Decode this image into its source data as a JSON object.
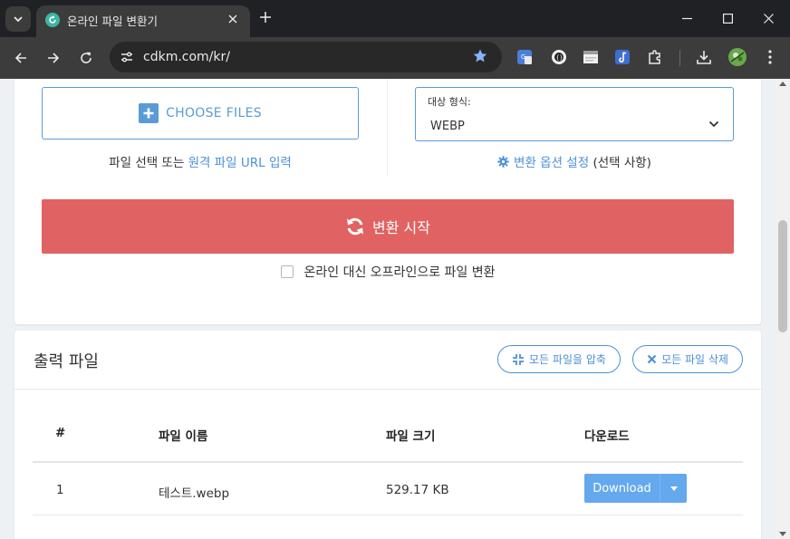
{
  "browser": {
    "tab_title": "온라인 파일 변환기",
    "url": "cdkm.com/kr/"
  },
  "converter": {
    "choose_files_label": "CHOOSE FILES",
    "file_hint_prefix": "파일 선택 또는 ",
    "file_hint_link": "원격 파일 URL 입력",
    "target_format_label": "대상 형식:",
    "target_format_value": "WEBP",
    "options_link": "변환 옵션 설정",
    "options_suffix": " (선택 사항)",
    "convert_button": "변환 시작",
    "offline_label": "온라인 대신 오프라인으로 파일 변환"
  },
  "output": {
    "title": "출력 파일",
    "compress_all": "모든 파일을 압축",
    "delete_all": "모든 파일 삭제",
    "columns": [
      "#",
      "파일 이름",
      "파일 크기",
      "다운로드"
    ],
    "rows": [
      {
        "index": "1",
        "name": "테스트.webp",
        "size": "529.17 KB",
        "download_label": "Download"
      }
    ]
  },
  "colors": {
    "accent_blue": "#4a90d9",
    "convert_red": "#e16262",
    "download_blue": "#64a8ee"
  }
}
